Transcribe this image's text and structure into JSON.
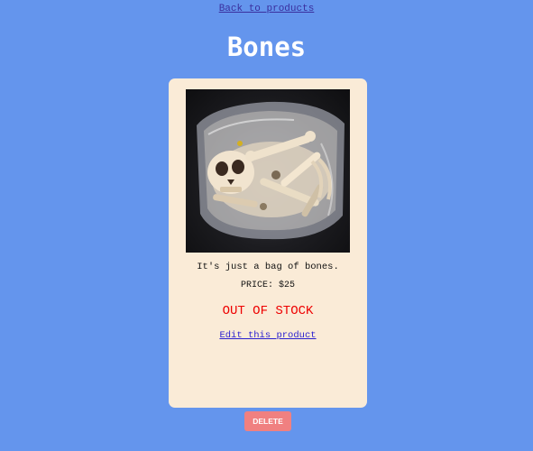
{
  "nav": {
    "back_label": "Back to products"
  },
  "product": {
    "title": "Bones",
    "image_alt": "bag of bones",
    "description": "It's just a bag of bones.",
    "price": "PRICE: $25",
    "stock_status": "OUT OF STOCK",
    "edit_label": "Edit this product"
  },
  "actions": {
    "delete_label": "DELETE"
  },
  "colors": {
    "page_background": "#6495ED",
    "card_background": "#FAEBD7",
    "stock_status": "#EE0000",
    "delete_button": "#F08080",
    "link": "#2A1FD0"
  }
}
